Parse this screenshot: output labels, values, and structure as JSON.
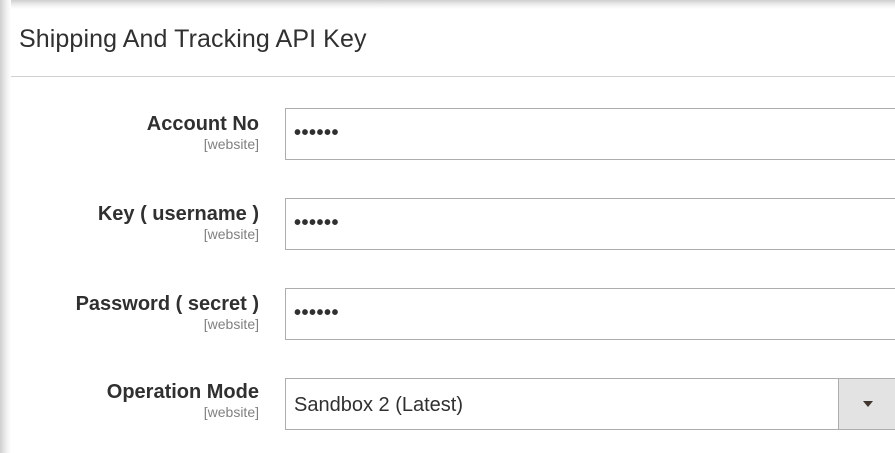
{
  "section": {
    "title": "Shipping And Tracking API Key"
  },
  "fields": {
    "account_no": {
      "label": "Account No",
      "scope": "[website]",
      "value": "••••••"
    },
    "key": {
      "label": "Key ( username )",
      "scope": "[website]",
      "value": "••••••"
    },
    "password": {
      "label": "Password ( secret )",
      "scope": "[website]",
      "value": "••••••"
    },
    "operation_mode": {
      "label": "Operation Mode",
      "scope": "[website]",
      "selected": "Sandbox 2 (Latest)",
      "icon": "chevron-down-icon"
    }
  },
  "colors": {
    "text": "#303030",
    "scope_text": "#808080",
    "border": "#adadad",
    "select_button": "#e3e3e3"
  }
}
